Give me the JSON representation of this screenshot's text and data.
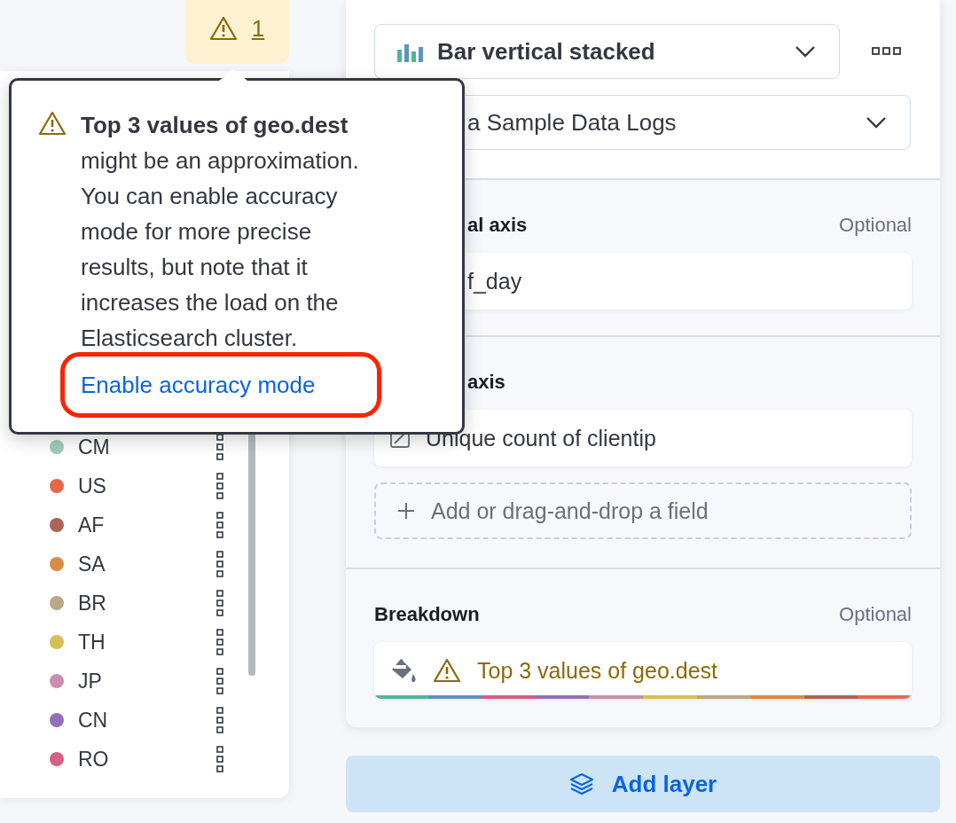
{
  "toolbar": {
    "warning_count": "1"
  },
  "popover": {
    "text": "**Top 3 values of geo.dest** might be an approximation. You can enable accuracy mode for more precise results, but note that it increases the load on the Elasticsearch cluster.",
    "link": "Enable accuracy mode",
    "link_highlighted": true
  },
  "legend": {
    "items": [
      {
        "label": "CM",
        "color": "#9dccba"
      },
      {
        "label": "US",
        "color": "#e7664c"
      },
      {
        "label": "AF",
        "color": "#aa6556"
      },
      {
        "label": "SA",
        "color": "#da8b45"
      },
      {
        "label": "BR",
        "color": "#b9a888"
      },
      {
        "label": "TH",
        "color": "#d6bf57"
      },
      {
        "label": "JP",
        "color": "#ca8eae"
      },
      {
        "label": "CN",
        "color": "#9170b8"
      },
      {
        "label": "RO",
        "color": "#d36086"
      }
    ]
  },
  "panel": {
    "chart_type": "Bar vertical stacked",
    "data_source": "a Sample Data Logs",
    "sections": [
      {
        "label": "al axis",
        "optional": "Optional",
        "fields": [
          {
            "kind": "plain",
            "text": "f_day"
          }
        ]
      },
      {
        "label": "axis",
        "fields": [
          {
            "kind": "metric",
            "text": "Unique count of clientip"
          },
          {
            "kind": "add",
            "text": "Add or drag-and-drop a field"
          }
        ]
      },
      {
        "label": "Breakdown",
        "optional": "Optional",
        "fields": [
          {
            "kind": "breakdown",
            "text": "Top 3 values of geo.dest",
            "warning": true,
            "palette": [
              {
                "color": "#54b399"
              },
              {
                "color": "#6092c0"
              },
              {
                "color": "#d36086"
              },
              {
                "color": "#9170b8"
              },
              {
                "color": "#ca8eae"
              },
              {
                "color": "#d6bf57"
              },
              {
                "color": "#b9a888"
              },
              {
                "color": "#da8b45"
              },
              {
                "color": "#aa6556"
              },
              {
                "color": "#e7664c"
              }
            ]
          }
        ]
      }
    ]
  },
  "add_layer": "Add layer"
}
